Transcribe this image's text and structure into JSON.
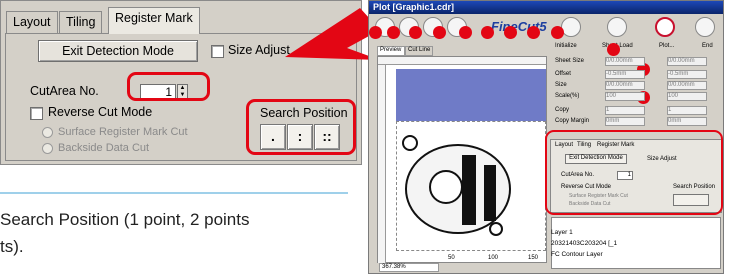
{
  "zoom_panel": {
    "tabs": [
      "Layout",
      "Tiling",
      "Register Mark"
    ],
    "exit_button": "Exit Detection Mode",
    "size_adjust": "Size Adjust",
    "cutarea_label": "CutArea No.",
    "cutarea_value": "1",
    "reverse_cut": "Reverse Cut Mode",
    "surface_option": "Surface Register Mark Cut",
    "backside_option": "Backside Data Cut",
    "search_position_title": "Search Position",
    "search_buttons": [
      ".",
      ":",
      "::"
    ]
  },
  "caption": {
    "line1": "Search Position (1 point, 2 points",
    "line2": "ts)."
  },
  "screenshot": {
    "title": "Plot [Graphic1.cdr]",
    "toolbar": {
      "initialize": "Initialize",
      "sheet_load": "Sheet Load",
      "plot": "Plot...",
      "end": "End",
      "brand": "FineCut5"
    },
    "view_tabs": [
      "Preview",
      "Cut Line"
    ],
    "fields": [
      {
        "label": "Sheet Size",
        "value": "0/0.00mm",
        "value2": "0/0.00mm"
      },
      {
        "label": "Offset",
        "value": "-0.5mm",
        "value2": "-0.5mm"
      },
      {
        "label": "Size",
        "value": "0/0.00mm",
        "value2": "0/0.00mm"
      },
      {
        "label": "Scale(%)",
        "value": "100",
        "value2": "100"
      },
      {
        "label": "Copy",
        "value": "1",
        "value2": "1"
      },
      {
        "label": "Copy Margin",
        "value": "0mm",
        "value2": "0mm"
      }
    ],
    "mini_panel": {
      "tabs": [
        "Layout",
        "Tiling",
        "Register Mark"
      ],
      "exit_button": "Exit Detection Mode",
      "size_adjust": "Size Adjust",
      "cutarea_label": "CutArea No.",
      "cutarea_value": "1",
      "reverse_cut": "Reverse Cut Mode",
      "surface_option": "Surface Register Mark Cut",
      "backside_option": "Backside Data Cut",
      "search_position": "Search Position"
    },
    "layers": [
      "Layer 1",
      "20321403C203204 [_1",
      "FC Contour Layer"
    ],
    "zoom_level": "367.38%",
    "ruler": [
      "50",
      "100",
      "150"
    ]
  }
}
